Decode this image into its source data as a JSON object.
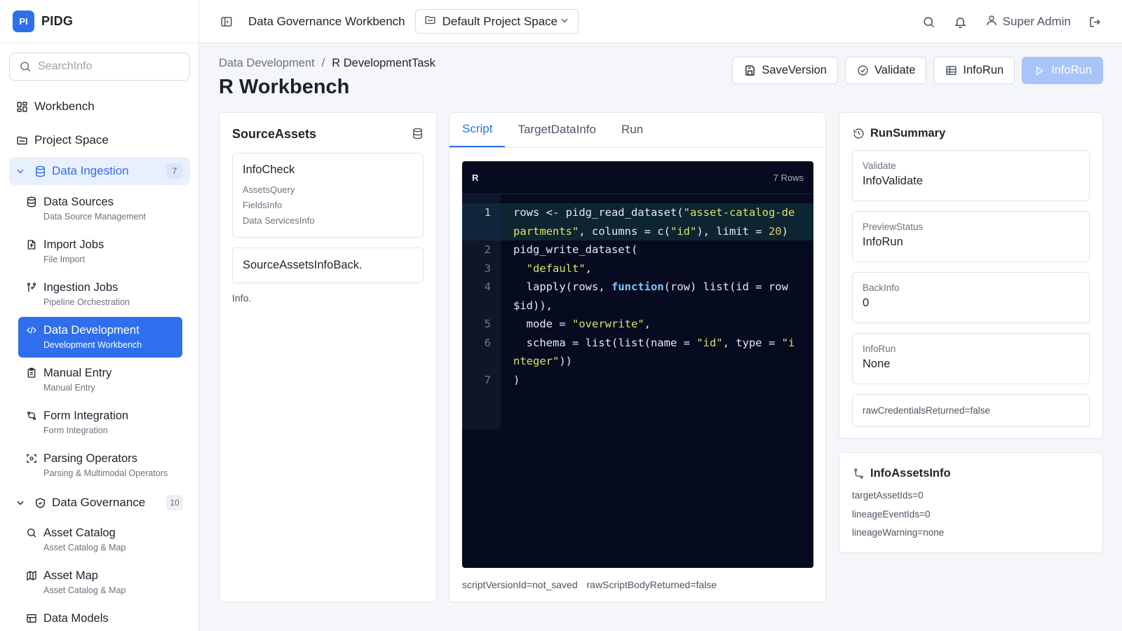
{
  "brand": {
    "logo": "PI",
    "name": "PIDG"
  },
  "search": {
    "placeholder": "SearchInfo"
  },
  "nav": {
    "top": [
      {
        "label": "Workbench",
        "icon": "grid-icon"
      },
      {
        "label": "Project Space",
        "icon": "folder-icon"
      }
    ],
    "groups": [
      {
        "label": "Data Ingestion",
        "count": "7",
        "open": true,
        "icon": "database-icon",
        "items": [
          {
            "label": "Data Sources",
            "sub": "Data Source Management",
            "icon": "database-icon"
          },
          {
            "label": "Import Jobs",
            "sub": "File Import",
            "icon": "file-upload-icon"
          },
          {
            "label": "Ingestion Jobs",
            "sub": "Pipeline Orchestration",
            "icon": "pipeline-icon"
          },
          {
            "label": "Data Development",
            "sub": "Development Workbench",
            "icon": "code-icon",
            "active": true
          },
          {
            "label": "Manual Entry",
            "sub": "Manual Entry",
            "icon": "clipboard-icon"
          },
          {
            "label": "Form Integration",
            "sub": "Form Integration",
            "icon": "workflow-icon"
          },
          {
            "label": "Parsing Operators",
            "sub": "Parsing & Multimodal Operators",
            "icon": "scan-icon"
          }
        ]
      },
      {
        "label": "Data Governance",
        "count": "10",
        "open": false,
        "icon": "shield-icon",
        "items": [
          {
            "label": "Asset Catalog",
            "sub": "Asset Catalog & Map",
            "icon": "search-icon"
          },
          {
            "label": "Asset Map",
            "sub": "Asset Catalog & Map",
            "icon": "map-icon"
          },
          {
            "label": "Data Models",
            "sub": "",
            "icon": "table-icon"
          }
        ]
      }
    ]
  },
  "topbar": {
    "title": "Data Governance Workbench",
    "project": "Default Project Space",
    "user": "Super Admin"
  },
  "page": {
    "breadcrumb": [
      "Data Development",
      "R DevelopmentTask"
    ],
    "title": "R Workbench",
    "actions": {
      "save": "SaveVersion",
      "validate": "Validate",
      "info_run": "InfoRun",
      "run": "InfoRun"
    }
  },
  "source": {
    "title": "SourceAssets",
    "item": {
      "name": "InfoCheck",
      "lines": [
        "AssetsQuery",
        "FieldsInfo",
        "Data ServicesInfo"
      ]
    },
    "back": "SourceAssetsInfoBack.",
    "note": "Info."
  },
  "editor": {
    "tabs": [
      "Script",
      "TargetDataInfo",
      "Run"
    ],
    "active_tab": 0,
    "lang": "R",
    "rows": "7 Rows",
    "lines": [
      {
        "n": "1",
        "highlight": true,
        "tokens": [
          [
            "t",
            "rows <- pidg_read_dataset("
          ],
          [
            "s",
            "\"asset-catalog-departments\""
          ],
          [
            "t",
            ", columns = c("
          ],
          [
            "s",
            "\"id\""
          ],
          [
            "t",
            "), limit = "
          ],
          [
            "n",
            "20"
          ],
          [
            "t",
            ")"
          ]
        ]
      },
      {
        "n": "2",
        "tokens": [
          [
            "t",
            "pidg_write_dataset("
          ]
        ]
      },
      {
        "n": "3",
        "tokens": [
          [
            "t",
            "  "
          ],
          [
            "s",
            "\"default\""
          ],
          [
            "t",
            ","
          ]
        ]
      },
      {
        "n": "4",
        "tokens": [
          [
            "t",
            "  lapply(rows, "
          ],
          [
            "k",
            "function"
          ],
          [
            "t",
            "(row) list(id = row$id)),"
          ]
        ]
      },
      {
        "n": "5",
        "tokens": [
          [
            "t",
            "  mode = "
          ],
          [
            "s",
            "\"overwrite\""
          ],
          [
            "t",
            ","
          ]
        ]
      },
      {
        "n": "6",
        "tokens": [
          [
            "t",
            "  schema = list(list(name = "
          ],
          [
            "s",
            "\"id\""
          ],
          [
            "t",
            ", type = "
          ],
          [
            "s",
            "\"integer\""
          ],
          [
            "t",
            "))"
          ]
        ]
      },
      {
        "n": "7",
        "tokens": [
          [
            "t",
            ")"
          ]
        ]
      }
    ],
    "footer": [
      "scriptVersionId=not_saved",
      "rawScriptBodyReturned=false"
    ]
  },
  "summary": {
    "title": "RunSummary",
    "stats": [
      {
        "key": "Validate",
        "value": "InfoValidate"
      },
      {
        "key": "PreviewStatus",
        "value": "InfoRun"
      },
      {
        "key": "BackInfo",
        "value": "0"
      },
      {
        "key": "InfoRun",
        "value": "None"
      }
    ],
    "flag": "rawCredentialsReturned=false"
  },
  "lineage": {
    "title": "InfoAssetsInfo",
    "lines": [
      "targetAssetIds=0",
      "lineageEventIds=0",
      "lineageWarning=none"
    ]
  },
  "colors": {
    "accent": "#2f6fed",
    "code_bg": "#060b1f",
    "string": "#d7e36a",
    "keyword": "#7fc8ff"
  }
}
